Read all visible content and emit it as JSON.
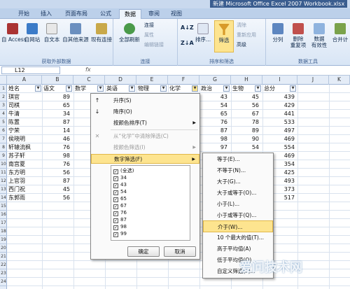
{
  "title_bar": {
    "text": "新建 Microsoft Office Excel 2007 Workbook.xlsx"
  },
  "tabs": [
    "开始",
    "插入",
    "页面布局",
    "公式",
    "数据",
    "审阅",
    "视图"
  ],
  "ribbon": {
    "ext_group": {
      "label": "获取外部数据",
      "buttons": [
        "自 Access",
        "自网站",
        "自文本",
        "自其他来源",
        "现有连接"
      ]
    },
    "conn_group": {
      "label": "连接",
      "refresh": "全部刷新",
      "items": [
        "连接",
        "属性",
        "编辑链接"
      ]
    },
    "sort_group": {
      "label": "排序和筛选",
      "sort": "排序...",
      "filter": "筛选",
      "items": [
        "清除",
        "重新应用",
        "高级"
      ]
    },
    "tools_group": {
      "label": "数据工具",
      "buttons": [
        "分列",
        "删除\n重复项",
        "数据\n有效性",
        "合并计"
      ]
    }
  },
  "formula_bar": {
    "name_box": "L12",
    "fx": "fx"
  },
  "columns": [
    "A",
    "B",
    "C",
    "D",
    "E",
    "F",
    "G",
    "H",
    "I",
    "J",
    "K"
  ],
  "headers": [
    "姓名",
    "语文",
    "数学",
    "英语",
    "物理",
    "化学",
    "政治",
    "生物",
    "总分"
  ],
  "rows": [
    {
      "n": "1"
    },
    {
      "n": "2",
      "name": "琪官",
      "b": "89",
      "g": "43",
      "h": "45",
      "i": "439"
    },
    {
      "n": "3",
      "name": "司棋",
      "b": "65",
      "g": "54",
      "h": "56",
      "i": "429"
    },
    {
      "n": "4",
      "name": "牛清",
      "b": "34",
      "g": "65",
      "h": "67",
      "i": "441"
    },
    {
      "n": "5",
      "name": "陈置",
      "b": "87",
      "g": "76",
      "h": "78",
      "i": "533"
    },
    {
      "n": "6",
      "name": "宁荣",
      "b": "14",
      "g": "87",
      "h": "89",
      "i": "497"
    },
    {
      "n": "7",
      "name": "侯晓明",
      "b": "46",
      "g": "98",
      "h": "90",
      "i": "469"
    },
    {
      "n": "8",
      "name": "轩辕流枫",
      "b": "76",
      "g": "97",
      "h": "54",
      "i": "554"
    },
    {
      "n": "9",
      "name": "苏子轩",
      "b": "98",
      "g": "",
      "h": "",
      "i": "469"
    },
    {
      "n": "10",
      "name": "南宫夏",
      "b": "76",
      "g": "",
      "h": "",
      "i": "354"
    },
    {
      "n": "11",
      "name": "东方明",
      "b": "56",
      "g": "",
      "h": "",
      "i": "425"
    },
    {
      "n": "12",
      "name": "上官羽",
      "b": "87",
      "g": "",
      "h": "",
      "i": "493"
    },
    {
      "n": "13",
      "name": "西门祝",
      "b": "45",
      "g": "",
      "h": "",
      "i": "373"
    },
    {
      "n": "14",
      "name": "东郭雨",
      "b": "56",
      "g": "",
      "h": "",
      "i": "517"
    },
    {
      "n": "15"
    },
    {
      "n": "16"
    },
    {
      "n": "17"
    },
    {
      "n": "18"
    },
    {
      "n": "19"
    },
    {
      "n": "20"
    },
    {
      "n": "21"
    },
    {
      "n": "22"
    },
    {
      "n": "23"
    },
    {
      "n": "24"
    }
  ],
  "filter_menu": {
    "items": [
      {
        "label": "升序(S)",
        "icon": "sort-ascending-icon",
        "disabled": false
      },
      {
        "label": "降序(O)",
        "icon": "sort-descending-icon",
        "disabled": false
      },
      {
        "label": "按颜色排序(T)",
        "icon": "",
        "disabled": false,
        "submenu": true
      },
      {
        "label": "从“化学”中清除筛选(C)",
        "icon": "clear-filter-icon",
        "disabled": true
      },
      {
        "label": "按颜色筛选(I)",
        "icon": "",
        "disabled": true,
        "submenu": true
      },
      {
        "label": "数字筛选(F)",
        "icon": "",
        "disabled": false,
        "submenu": true,
        "highlighted": true
      }
    ],
    "values": [
      "(全选)",
      "34",
      "43",
      "54",
      "65",
      "67",
      "76",
      "87",
      "98",
      "99"
    ],
    "ok": "确定",
    "cancel": "取消"
  },
  "number_filter_menu": {
    "items": [
      "等于(E)...",
      "不等于(N)...",
      "大于(G)...",
      "大于或等于(O)...",
      "小于(L)...",
      "小于或等于(Q)...",
      "介于(W)...",
      "10 个最大的值(T)...",
      "高于平均值(A)",
      "低于平均值(O)",
      "自定义筛选(F)..."
    ],
    "highlighted_index": 6
  },
  "watermark": "爱问技术网"
}
